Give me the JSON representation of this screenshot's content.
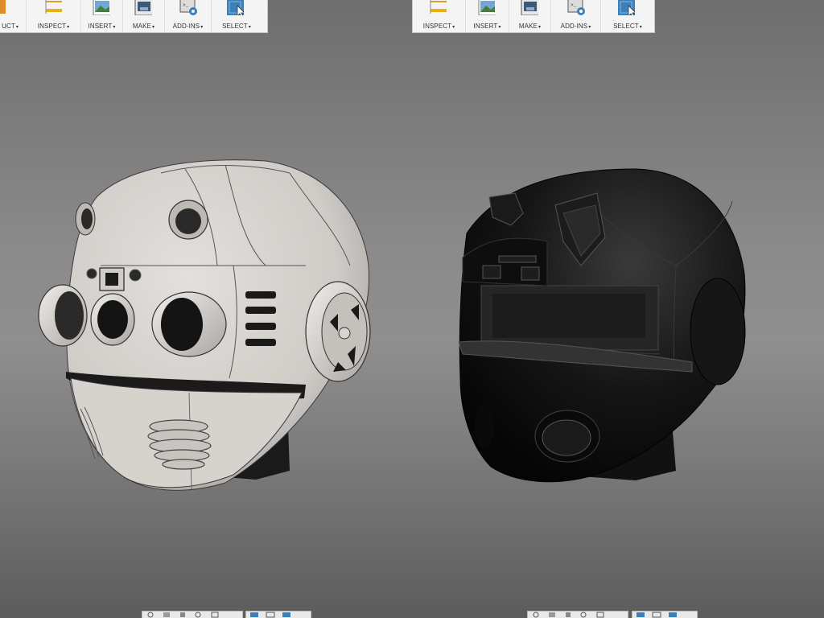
{
  "toolbar_left": {
    "items": [
      {
        "label": "UCT",
        "icon": "construct-icon"
      },
      {
        "label": "INSPECT",
        "icon": "measure-icon"
      },
      {
        "label": "INSERT",
        "icon": "insert-image-icon"
      },
      {
        "label": "MAKE",
        "icon": "make-3dprint-icon"
      },
      {
        "label": "ADD-INS",
        "icon": "addins-script-icon"
      },
      {
        "label": "SELECT",
        "icon": "select-cursor-icon"
      }
    ]
  },
  "toolbar_right": {
    "items": [
      {
        "label": "INSPECT",
        "icon": "measure-icon"
      },
      {
        "label": "INSERT",
        "icon": "insert-image-icon"
      },
      {
        "label": "MAKE",
        "icon": "make-3dprint-icon"
      },
      {
        "label": "ADD-INS",
        "icon": "addins-script-icon"
      },
      {
        "label": "SELECT",
        "icon": "select-cursor-icon"
      }
    ]
  },
  "caret": "▾",
  "colors": {
    "select_accent": "#3d7fb8",
    "construct_accent": "#e08a2c",
    "helmet_light": "#d6d4d0",
    "helmet_dark": "#161616"
  }
}
